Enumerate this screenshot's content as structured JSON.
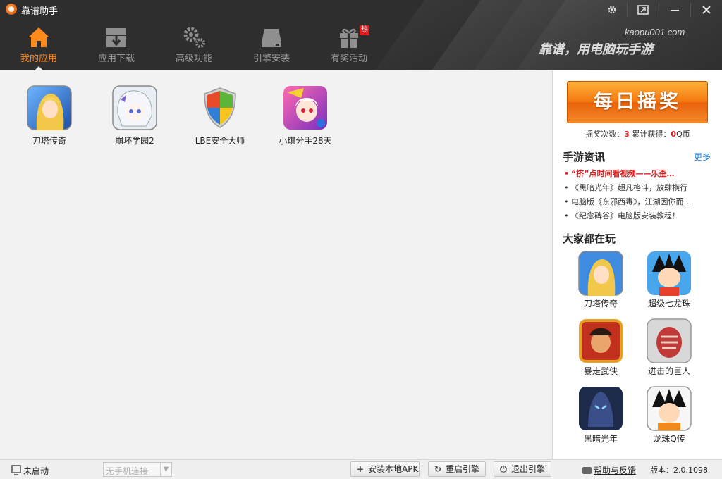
{
  "window": {
    "title": "靠谱助手"
  },
  "nav": {
    "items": [
      {
        "label": "我的应用",
        "active": true,
        "icon": "home-icon"
      },
      {
        "label": "应用下载",
        "icon": "download-box-icon"
      },
      {
        "label": "高级功能",
        "icon": "gears-icon"
      },
      {
        "label": "引擎安装",
        "icon": "drive-icon"
      },
      {
        "label": "有奖活动",
        "icon": "gift-icon",
        "badge": "热"
      }
    ]
  },
  "brand": {
    "url": "kaopu001.com",
    "slogan": "靠谱，用电脑玩手游"
  },
  "my_apps": [
    {
      "name": "刀塔传奇"
    },
    {
      "name": "崩坏学园2"
    },
    {
      "name": "LBE安全大师"
    },
    {
      "name": "小琪分手28天"
    }
  ],
  "sidebar": {
    "lottery_button": "每日摇奖",
    "stats": {
      "count_label": "摇奖次数：",
      "count": "3",
      "total_label": "累计获得：",
      "total": "0",
      "unit": "Q币"
    },
    "news_title": "手游资讯",
    "more": "更多",
    "news": [
      {
        "text": "“挤”点时间看视频——乐歪…",
        "hot": true
      },
      {
        "text": "《黑暗光年》超凡格斗，放肆横行"
      },
      {
        "text": "电脑版《东邪西毒》，江湖因你而…"
      },
      {
        "text": "《纪念碑谷》电脑版安装教程！"
      }
    ],
    "popular_title": "大家都在玩",
    "popular": [
      {
        "name": "刀塔传奇"
      },
      {
        "name": "超级七龙珠"
      },
      {
        "name": "暴走武侠"
      },
      {
        "name": "进击的巨人"
      },
      {
        "name": "黑暗光年"
      },
      {
        "name": "龙珠Q传"
      }
    ]
  },
  "statusbar": {
    "engine_status": "未启动",
    "device_select": "无手机连接",
    "install_apk": "安装本地APK",
    "restart_engine": "重启引擎",
    "exit_engine": "退出引擎",
    "help": "帮助与反馈",
    "version": "版本：2.0.1098"
  },
  "colors": {
    "accent": "#ff8a1c",
    "hot": "#e01c1c",
    "link": "#1a7fd8",
    "header": "#2e2e2e"
  }
}
